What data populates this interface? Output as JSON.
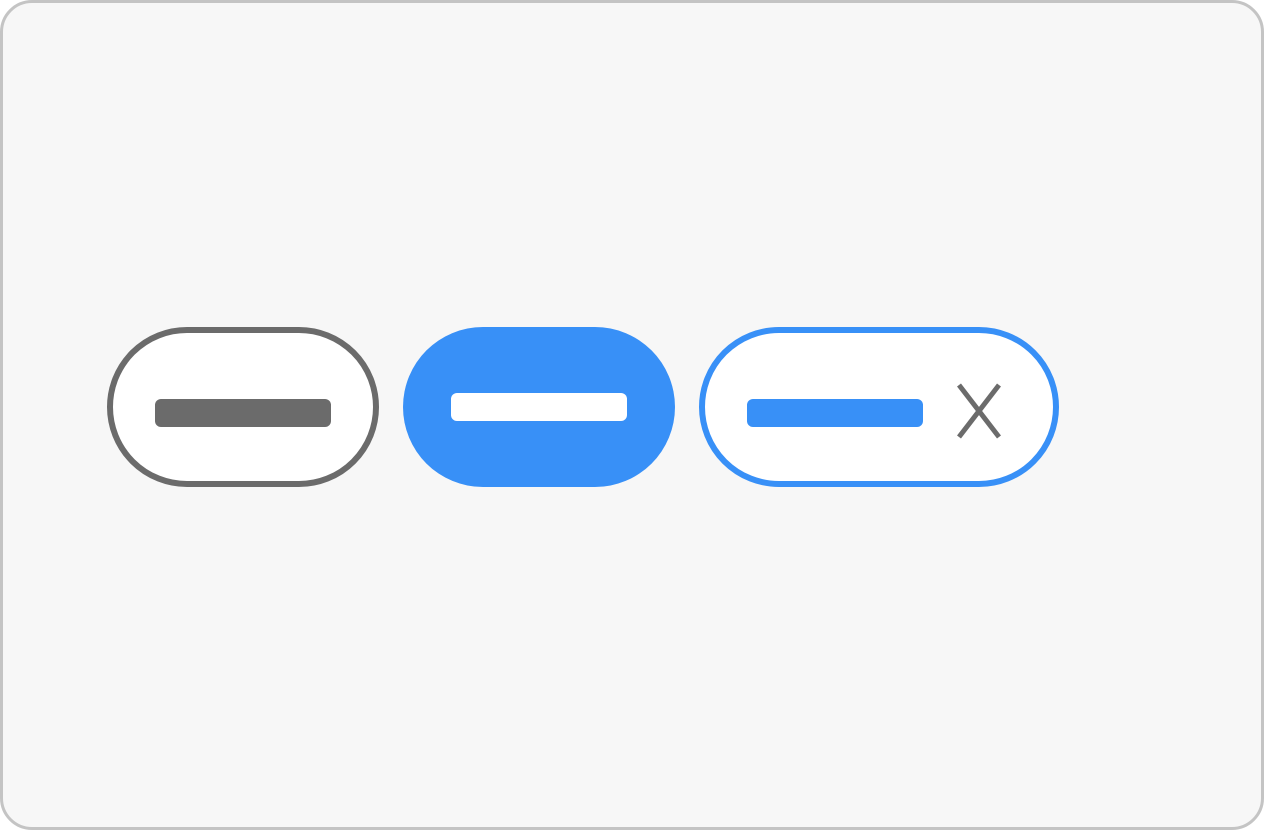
{
  "chips": [
    {
      "state": "default",
      "label": ""
    },
    {
      "state": "selected",
      "label": ""
    },
    {
      "state": "removable",
      "label": "",
      "remove_icon": "close-icon"
    }
  ],
  "colors": {
    "background": "#f7f7f7",
    "frame_border": "#c4c4c4",
    "neutral": "#6b6b6b",
    "accent": "#3890f7",
    "surface": "#ffffff"
  }
}
